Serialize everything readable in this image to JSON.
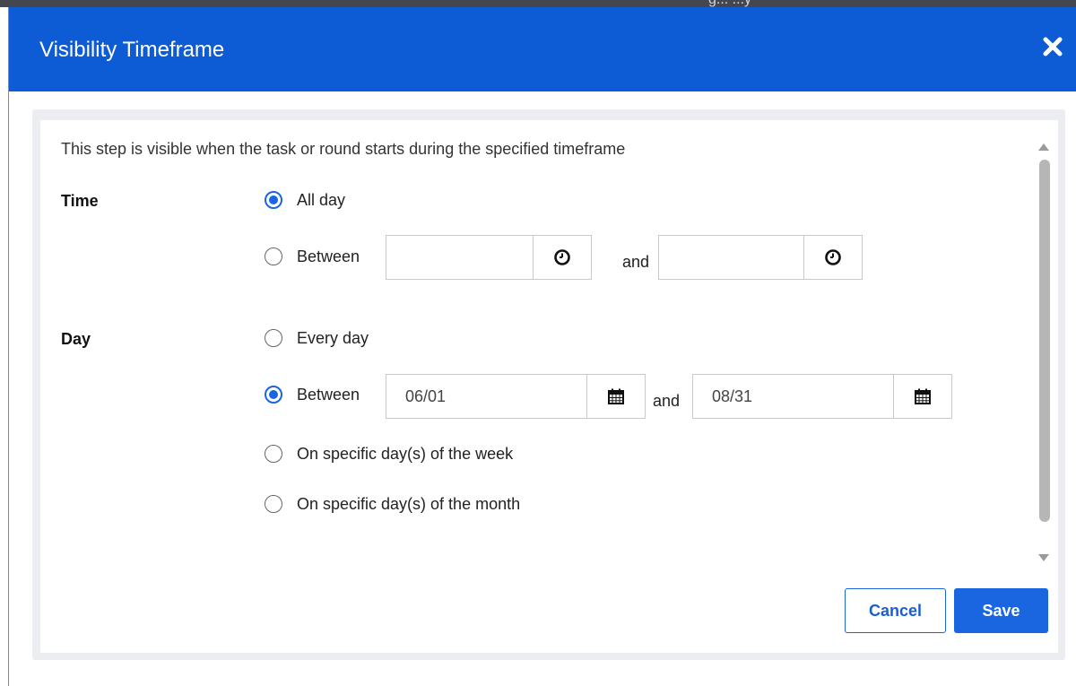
{
  "background_window": {
    "partial_text": "g... ...y"
  },
  "dialog": {
    "title": "Visibility Timeframe",
    "description": "This step is visible when the task or round starts during the specified timeframe",
    "colors": {
      "header": "#0e5bd6",
      "accent": "#1a66e0"
    }
  },
  "time": {
    "label": "Time",
    "selected": "all_day",
    "options": {
      "all_day": "All day",
      "between": "Between"
    },
    "start_value": "",
    "end_value": "",
    "and_label": "and",
    "icon": "clock-icon"
  },
  "day": {
    "label": "Day",
    "selected": "between",
    "options": {
      "every_day": "Every day",
      "between": "Between",
      "week": "On specific day(s) of the week",
      "month": "On specific day(s) of the month"
    },
    "start_value": "06/01",
    "end_value": "08/31",
    "and_label": "and",
    "icon": "calendar-icon"
  },
  "buttons": {
    "cancel": "Cancel",
    "save": "Save"
  }
}
